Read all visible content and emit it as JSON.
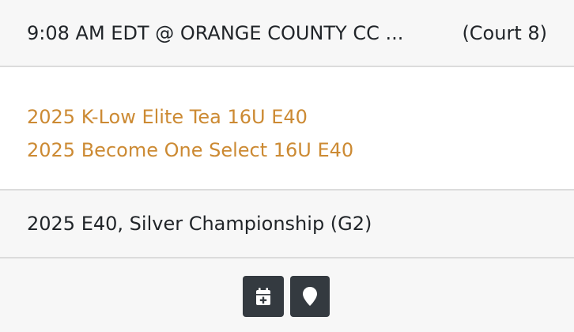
{
  "game": {
    "time_location": "9:08 AM EDT @ ORANGE COUNTY CC ...",
    "court": "(Court 8)"
  },
  "teams": [
    {
      "name": "2025 K-Low Elite Tea 16U E40"
    },
    {
      "name": "2025 Become One Select 16U E40"
    }
  ],
  "division": {
    "label": "2025 E40, Silver Championship (G2)"
  },
  "actions": {
    "calendar_icon": "calendar-plus-icon",
    "location_icon": "map-pin-icon"
  },
  "colors": {
    "link": "#cc8a33",
    "button_bg": "#343a40",
    "panel_bg": "#f7f7f7",
    "divider": "#dcdcdc"
  }
}
